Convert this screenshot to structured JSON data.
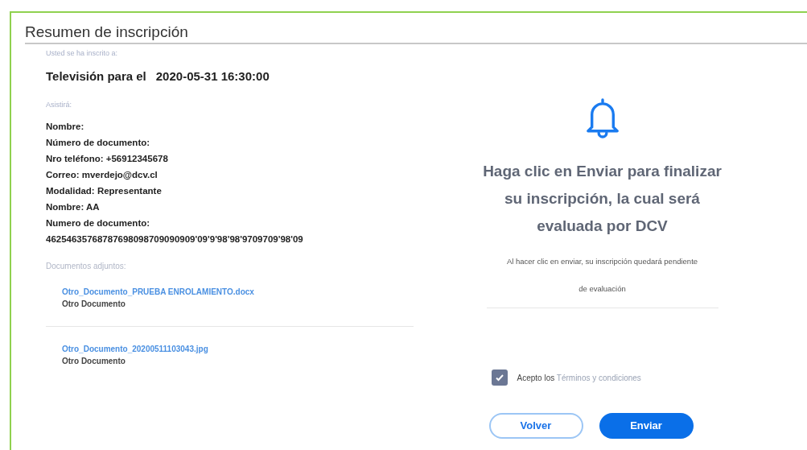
{
  "header": {
    "title": "Resumen de inscripción"
  },
  "summary": {
    "enrolled_label": "Usted se ha inscrito a:",
    "event": "Televisión para el",
    "datetime": "2020-05-31 16:30:00",
    "attendee_label": "Asistirá:",
    "attendee_lines": [
      "Nombre:",
      "Número de documento:",
      "Nro teléfono: +56912345678",
      "Correo: mverdejo@dcv.cl",
      "Modalidad: Representante",
      "Nombre: AA",
      "Numero de documento:",
      "46254635768787698098709090909'09'9'98'98'9709709'98'09"
    ],
    "documents_label": "Documentos adjuntos:",
    "documents": [
      {
        "file": "Otro_Documento_PRUEBA ENROLAMIENTO.docx",
        "type": "Otro Documento"
      },
      {
        "file": "Otro_Documento_20200511103043.jpg",
        "type": "Otro Documento"
      }
    ]
  },
  "confirm": {
    "message": "Haga clic en Enviar para finalizar su inscripción, la cual será evaluada por DCV",
    "note_lines": [
      "Al hacer clic en enviar, su inscripción quedará pendiente",
      "de evaluación"
    ],
    "terms": {
      "checked": true,
      "text": "Acepto los",
      "link": "Términos y condiciones"
    },
    "buttons": [
      {
        "label": "Volver",
        "kind": "secondary"
      },
      {
        "label": "Enviar",
        "kind": "primary"
      }
    ]
  }
}
